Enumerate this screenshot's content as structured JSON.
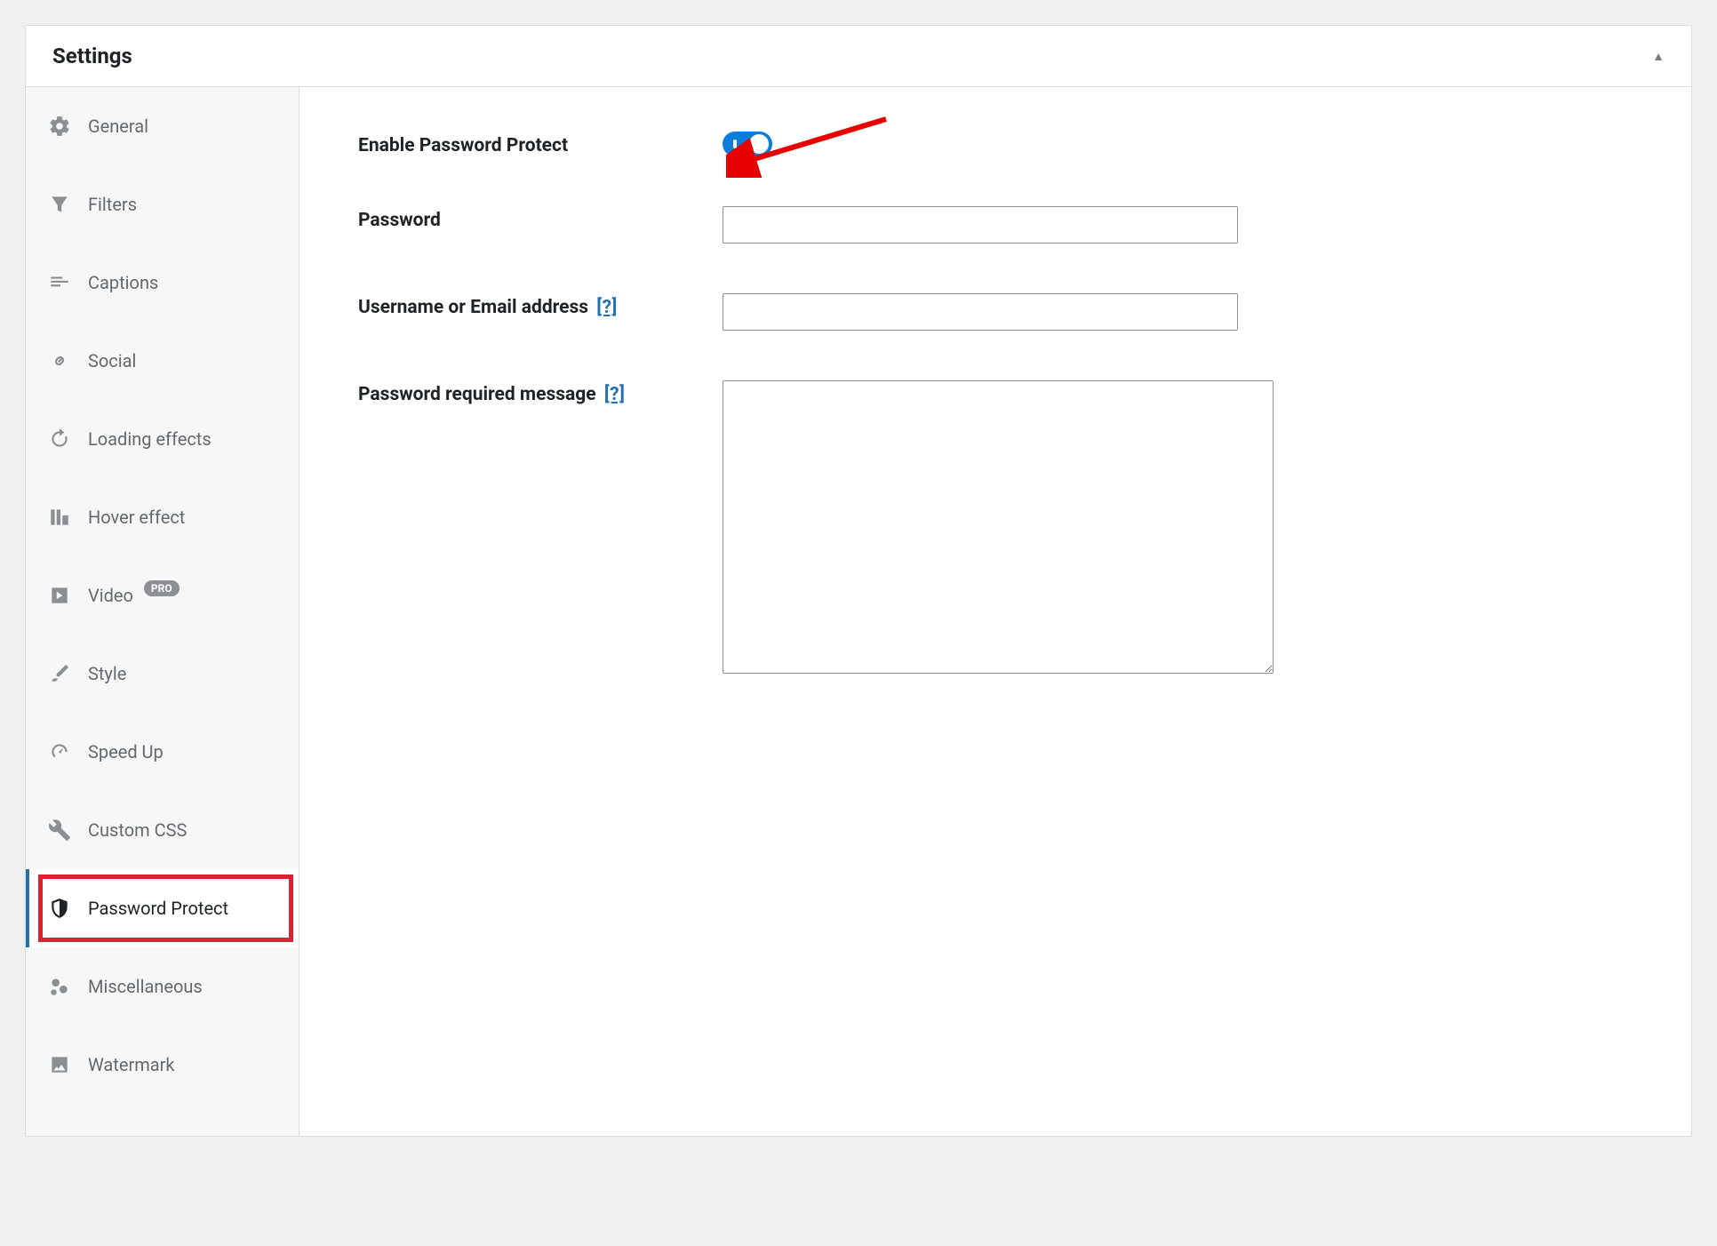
{
  "header": {
    "title": "Settings"
  },
  "sidebar": {
    "items": [
      {
        "label": "General",
        "icon": "gear-icon"
      },
      {
        "label": "Filters",
        "icon": "filter-icon"
      },
      {
        "label": "Captions",
        "icon": "captions-icon"
      },
      {
        "label": "Social",
        "icon": "link-icon"
      },
      {
        "label": "Loading effects",
        "icon": "reload-icon"
      },
      {
        "label": "Hover effect",
        "icon": "hover-icon"
      },
      {
        "label": "Video",
        "icon": "play-icon",
        "badge": "PRO"
      },
      {
        "label": "Style",
        "icon": "brush-icon"
      },
      {
        "label": "Speed Up",
        "icon": "gauge-icon"
      },
      {
        "label": "Custom CSS",
        "icon": "wrench-icon"
      },
      {
        "label": "Password Protect",
        "icon": "shield-icon",
        "active": true,
        "highlight": true
      },
      {
        "label": "Miscellaneous",
        "icon": "misc-icon"
      },
      {
        "label": "Watermark",
        "icon": "image-icon"
      }
    ]
  },
  "form": {
    "enable_label": "Enable Password Protect",
    "enable_value": true,
    "password_label": "Password",
    "password_value": "",
    "username_label": "Username or Email address",
    "username_help": "[?]",
    "username_value": "",
    "message_label": "Password required message",
    "message_help": "[?]",
    "message_value": ""
  }
}
